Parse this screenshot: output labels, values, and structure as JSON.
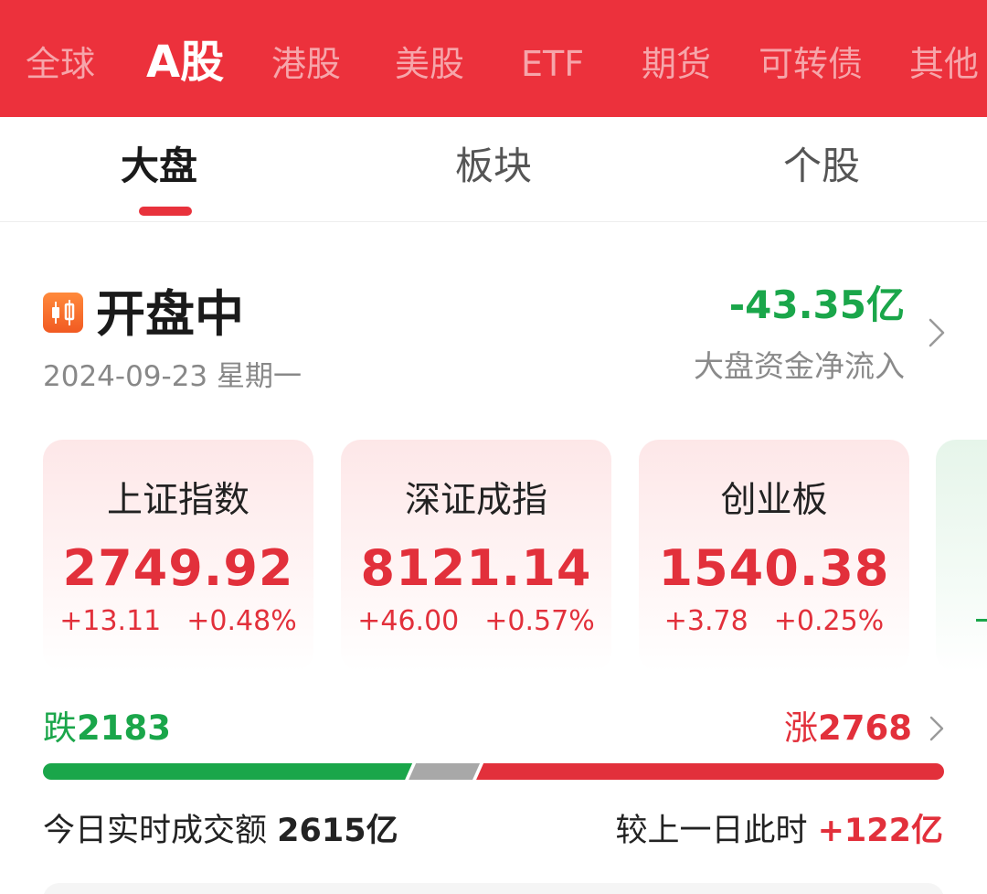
{
  "market_tabs": [
    {
      "label": "全球",
      "active": false
    },
    {
      "label": "A股",
      "active": true
    },
    {
      "label": "港股",
      "active": false
    },
    {
      "label": "美股",
      "active": false
    },
    {
      "label": "ETF",
      "active": false
    },
    {
      "label": "期货",
      "active": false
    },
    {
      "label": "可转债",
      "active": false
    },
    {
      "label": "其他",
      "active": false
    }
  ],
  "sub_tabs": [
    {
      "label": "大盘",
      "active": true
    },
    {
      "label": "板块",
      "active": false
    },
    {
      "label": "个股",
      "active": false
    }
  ],
  "market_status": {
    "icon": "candlestick-icon",
    "title": "开盘中",
    "date": "2024-09-23 星期一"
  },
  "fund_flow": {
    "value": "-43.35亿",
    "label": "大盘资金净流入"
  },
  "indices": [
    {
      "name": "上证指数",
      "value": "2749.92",
      "change": "+13.11",
      "change_pct": "+0.48%"
    },
    {
      "name": "深证成指",
      "value": "8121.14",
      "change": "+46.00",
      "change_pct": "+0.57%"
    },
    {
      "name": "创业板",
      "value": "1540.38",
      "change": "+3.78",
      "change_pct": "+0.25%"
    }
  ],
  "breadth": {
    "fall_label": "跌",
    "fall_count": "2183",
    "rise_label": "涨",
    "rise_count": "2768",
    "fall": 2183,
    "flat_fraction": 0.075,
    "rise": 2768
  },
  "turnover": {
    "label": "今日实时成交额",
    "value": "2615亿",
    "compare_label": "较上一日此时",
    "compare_value": "+122亿"
  },
  "colors": {
    "brand_red": "#ec313c",
    "up_red": "#e2303b",
    "down_green": "#1aa64a",
    "flat_gray": "#a8a8a8"
  }
}
